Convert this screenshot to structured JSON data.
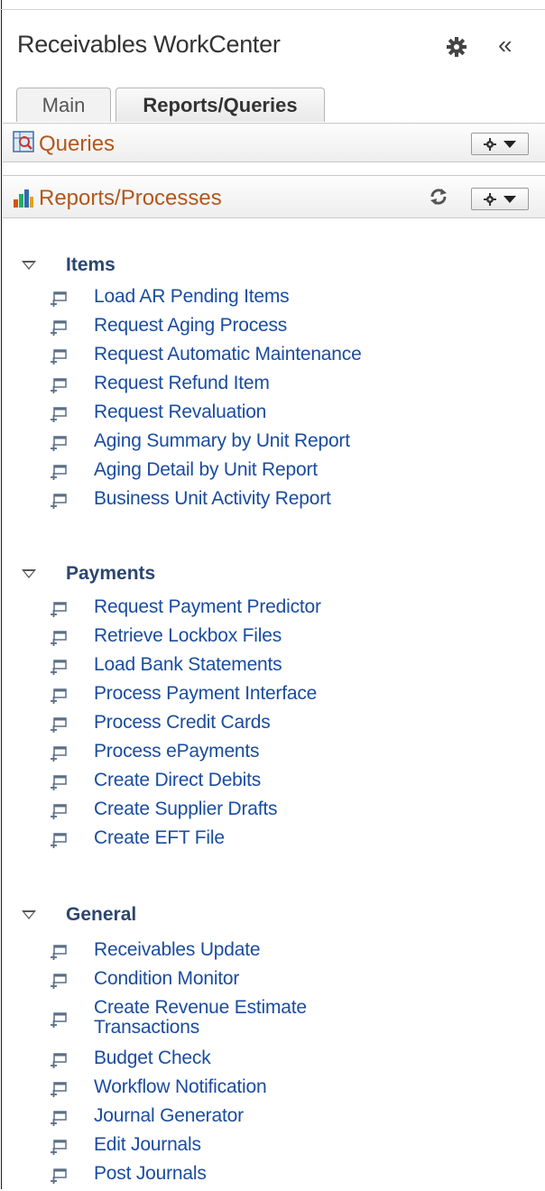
{
  "header": {
    "title": "Receivables WorkCenter",
    "collapse_glyph": "«"
  },
  "tabs": [
    {
      "label": "Main",
      "active": false
    },
    {
      "label": "Reports/Queries",
      "active": true
    }
  ],
  "pagelets": {
    "queries": {
      "title": "Queries",
      "icon": "query-icon"
    },
    "reports": {
      "title": "Reports/Processes",
      "icon": "bar-chart-icon"
    }
  },
  "sections": {
    "items": {
      "title": "Items",
      "links": [
        "Load AR Pending Items",
        "Request Aging Process",
        "Request Automatic Maintenance",
        "Request Refund Item",
        "Request Revaluation",
        "Aging Summary by Unit Report",
        "Aging Detail by Unit Report",
        "Business Unit Activity Report"
      ]
    },
    "payments": {
      "title": "Payments",
      "links": [
        "Request Payment Predictor",
        "Retrieve Lockbox Files",
        "Load Bank Statements",
        "Process Payment Interface",
        "Process Credit Cards",
        "Process ePayments",
        "Create Direct Debits",
        "Create Supplier Drafts",
        "Create EFT File"
      ]
    },
    "general": {
      "title": "General",
      "links": [
        "Receivables Update",
        "Condition Monitor",
        "Create Revenue Estimate Transactions",
        "Budget Check",
        "Workflow Notification",
        "Journal Generator",
        "Edit Journals",
        "Post Journals"
      ]
    }
  },
  "colors": {
    "link": "#1a4ca0",
    "section_title": "#2b4670",
    "pagelet_title": "#b4561b"
  }
}
